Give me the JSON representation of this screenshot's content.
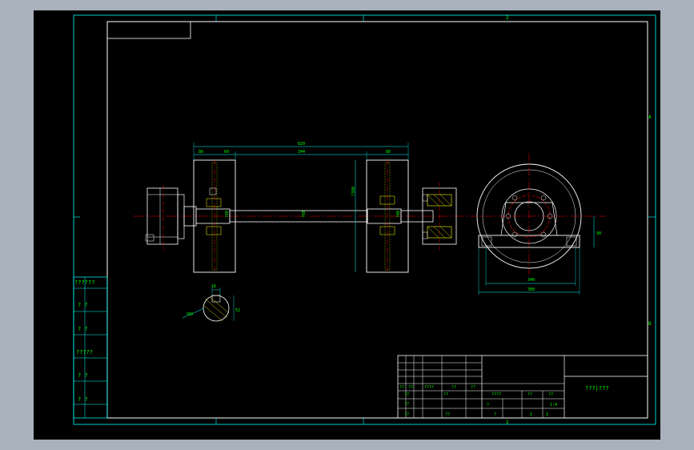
{
  "drawing": {
    "title_block_name": "???|???",
    "zone_top": "2",
    "zone_bottom": "2",
    "zone_right_upper": "A",
    "zone_right_lower": "B",
    "side_labels": [
      "??????",
      "? ?",
      "? ?",
      "?????",
      "? ?",
      "? ?"
    ],
    "title_block_rows": [
      {
        "c1": "??",
        "c2": "??",
        "c3": "????",
        "c4": "??",
        "c5": "??"
      },
      {
        "c1": "??",
        "c2": "",
        "c3": "??",
        "c4": "",
        "c5": ""
      },
      {
        "c1": "??",
        "c2": "",
        "c3": "",
        "c4": "",
        "c5": ""
      },
      {
        "c1": "??",
        "c2": "",
        "c3": "??",
        "c4": "",
        "c5": ""
      }
    ],
    "tb_mid": {
      "a": "????",
      "b": "??",
      "c": "??",
      "d": "1:4",
      "e": "?",
      "f": "?",
      "g": "1",
      "h": "1"
    },
    "dimensions": {
      "overall_length": "820",
      "between_wheels": "344",
      "wheel_left_a": "80",
      "wheel_left_b": "60",
      "wheel_right": "80",
      "wheel_dia": "?380",
      "shaft_dia_left": "?80",
      "shaft_dia_mid": "?60",
      "shaft_dia_right": "?80",
      "side_inner": "340",
      "side_outer": "380",
      "side_height": "90",
      "key_width": "16",
      "key_dia": "?60",
      "key_depth": "52"
    }
  },
  "colors": {
    "frame": "#00ffff",
    "outline": "#ffffff",
    "center": "#ff0000",
    "text": "#00ff00",
    "hatch": "#ffff00"
  }
}
